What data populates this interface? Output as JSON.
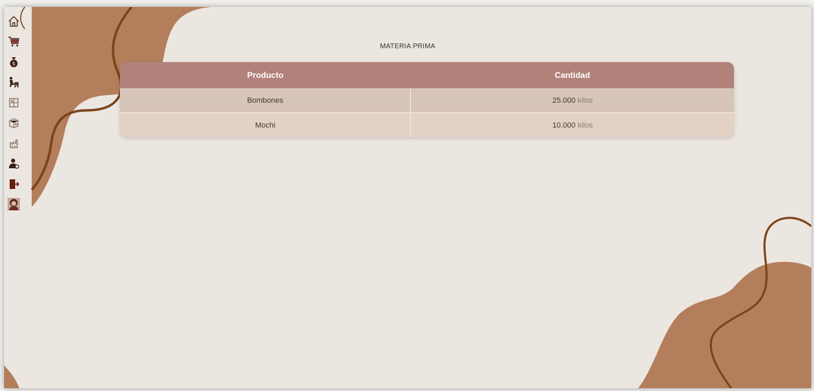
{
  "page": {
    "title": "MATERIA PRIMA"
  },
  "sidebar": {
    "items": [
      {
        "icon": "home-icon"
      },
      {
        "icon": "shopping-cart-icon"
      },
      {
        "icon": "money-bag-icon"
      },
      {
        "icon": "delivery-icon"
      },
      {
        "icon": "box-icon"
      },
      {
        "icon": "package-icon"
      },
      {
        "icon": "production-icon"
      },
      {
        "icon": "user-settings-icon"
      },
      {
        "icon": "logout-icon"
      },
      {
        "icon": "profile-avatar"
      }
    ]
  },
  "table": {
    "headers": [
      "Producto",
      "Cantidad"
    ],
    "rows": [
      {
        "producto": "Bombones",
        "cantidad": "25.000",
        "unidad": "kilos"
      },
      {
        "producto": "Mochi",
        "cantidad": "10.000",
        "unidad": "kilos"
      }
    ]
  },
  "colors": {
    "background": "#ebe6e0",
    "blob": "#b37e5b",
    "line": "#7a4418",
    "header": "#b1827a",
    "row1": "#d8c5b9",
    "row2": "#e4d1c5"
  }
}
